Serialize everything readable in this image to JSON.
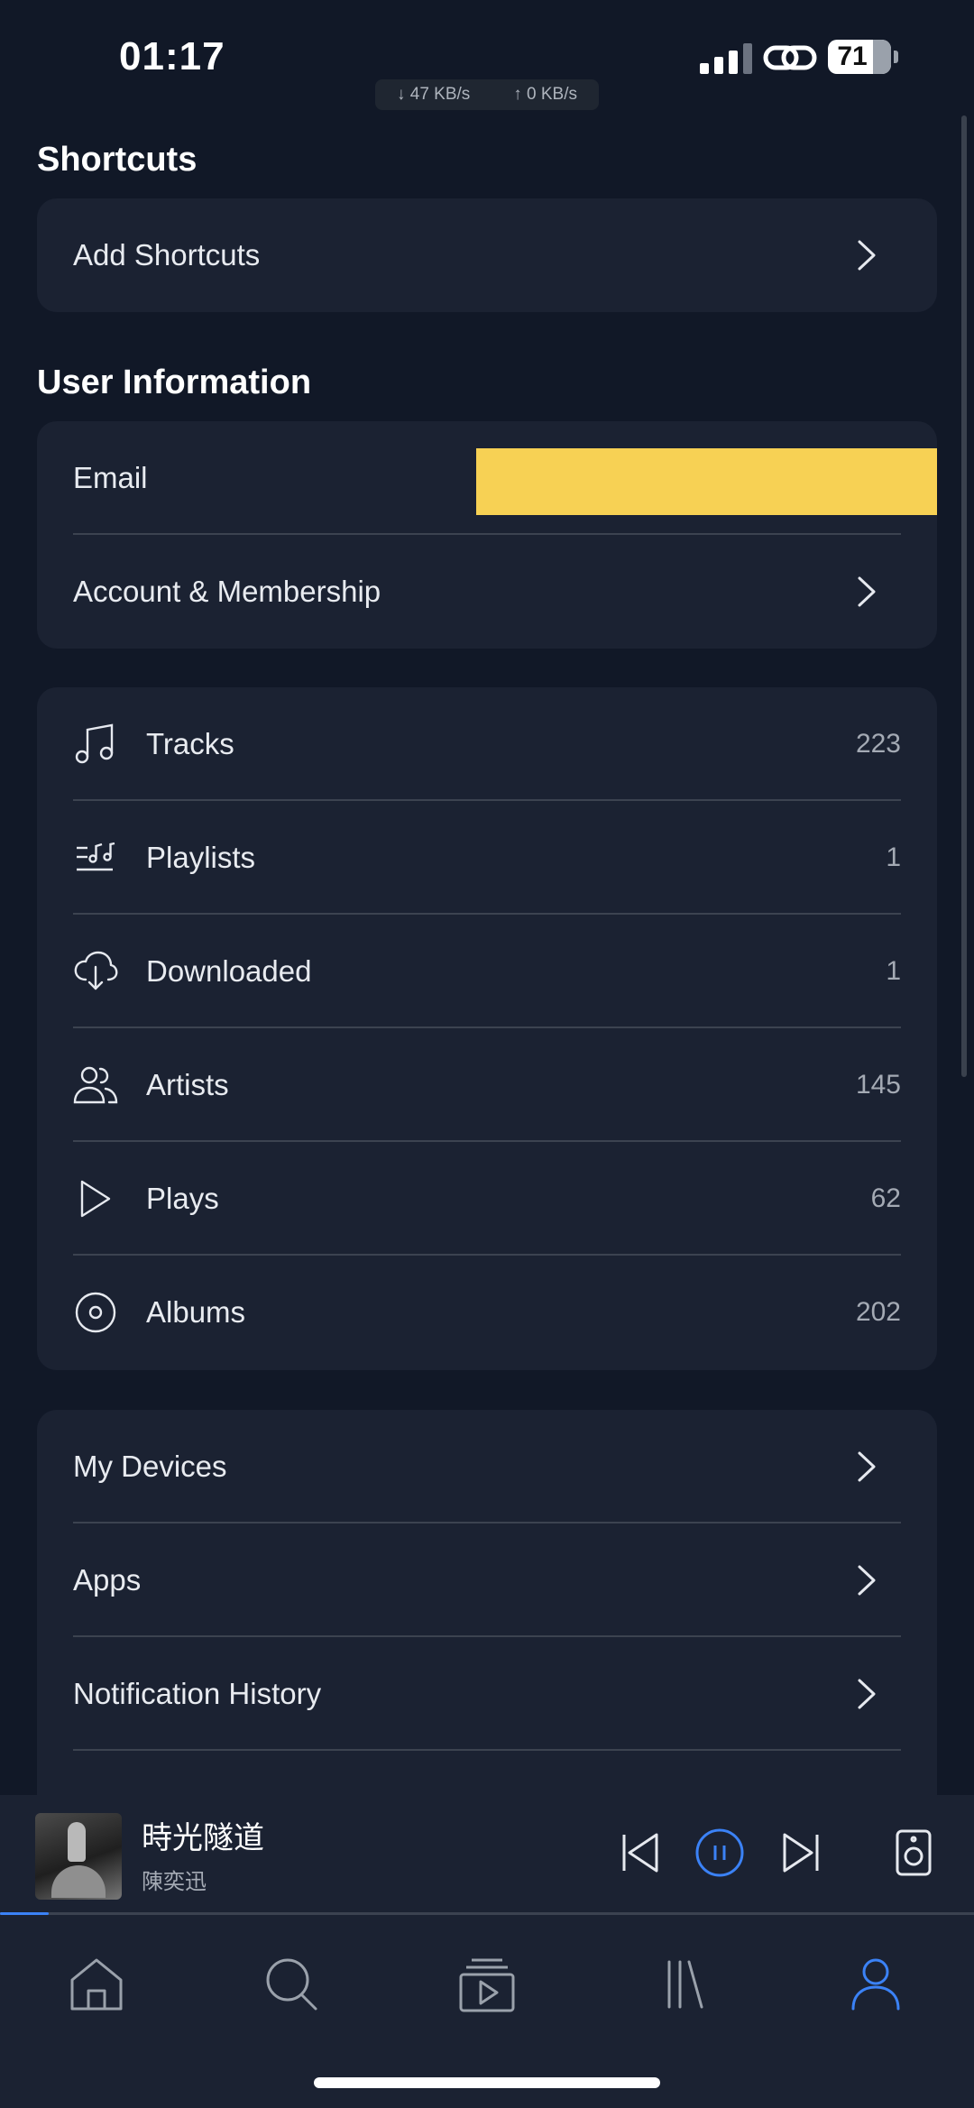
{
  "status_bar": {
    "time": "01:17",
    "battery_level": "71",
    "battery_fraction": 0.71,
    "download_speed": "↓ 47 KB/s",
    "upload_speed": "↑ 0 KB/s"
  },
  "shortcuts": {
    "title": "Shortcuts",
    "add_label": "Add Shortcuts"
  },
  "user_info": {
    "title": "User Information",
    "email_label": "Email",
    "account_label": "Account & Membership"
  },
  "library_stats": [
    {
      "label": "Tracks",
      "count": "223",
      "icon": "music-note-icon"
    },
    {
      "label": "Playlists",
      "count": "1",
      "icon": "playlist-icon"
    },
    {
      "label": "Downloaded",
      "count": "1",
      "icon": "cloud-download-icon"
    },
    {
      "label": "Artists",
      "count": "145",
      "icon": "users-icon"
    },
    {
      "label": "Plays",
      "count": "62",
      "icon": "play-icon"
    },
    {
      "label": "Albums",
      "count": "202",
      "icon": "disc-icon"
    }
  ],
  "settings_links": [
    {
      "label": "My Devices"
    },
    {
      "label": "Apps"
    },
    {
      "label": "Notification History"
    }
  ],
  "now_playing": {
    "title": "時光隧道",
    "artist": "陳奕迅",
    "progress": 0.05
  },
  "tabs": [
    {
      "name": "home",
      "icon": "home-icon",
      "active": false
    },
    {
      "name": "search",
      "icon": "search-icon",
      "active": false
    },
    {
      "name": "video",
      "icon": "video-icon",
      "active": false
    },
    {
      "name": "library",
      "icon": "library-icon",
      "active": false
    },
    {
      "name": "profile",
      "icon": "user-icon",
      "active": true
    }
  ],
  "colors": {
    "background": "#111827",
    "card": "#1b2232",
    "accent": "#3b82f6",
    "redaction": "#f7d154"
  }
}
